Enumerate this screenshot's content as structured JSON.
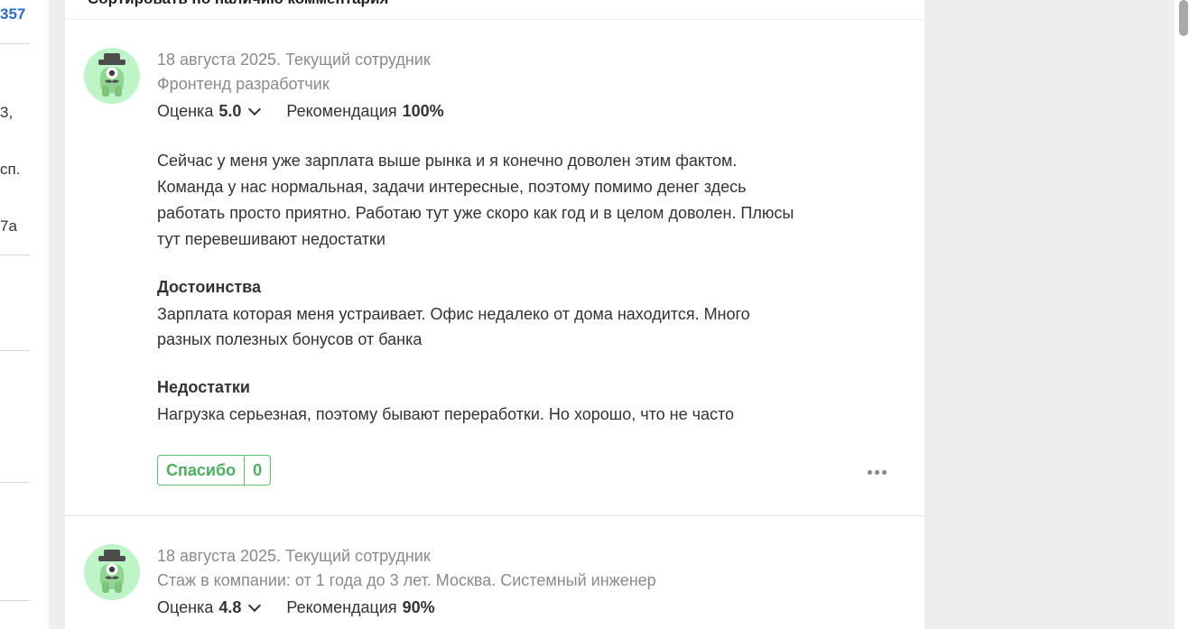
{
  "sidebar_fragments": {
    "f1": "357",
    "f2": "3,",
    "f3": "сп.",
    "f4": "7а"
  },
  "sort_bar": {
    "label": "Сортировать по наличию комментария"
  },
  "reviews": [
    {
      "date_status": "18 августа 2025. Текущий сотрудник",
      "position": "Фронтенд разработчик",
      "rating_label": "Оценка",
      "rating_value": "5.0",
      "recommend_label": "Рекомендация",
      "recommend_value": "100%",
      "body": "Сейчас у меня уже зарплата выше рынка и я конечно доволен этим фактом. Команда у нас нормальная, задачи интересные, поэтому помимо денег здесь работать просто приятно. Работаю тут уже скоро как год и в целом доволен. Плюсы тут перевешивают недостатки",
      "pros_title": "Достоинства",
      "pros_text": "Зарплата которая меня устраивает. Офис недалеко от дома находится. Много разных полезных бонусов от банка",
      "cons_title": "Недостатки",
      "cons_text": "Нагрузка серьезная, поэтому бывают переработки. Но хорошо, что не часто",
      "thanks_label": "Спасибо",
      "thanks_count": "0"
    },
    {
      "date_status": "18 августа 2025. Текущий сотрудник",
      "position": "Стаж в компании: от 1 года до 3 лет. Москва. Системный инженер",
      "rating_label": "Оценка",
      "rating_value": "4.8",
      "recommend_label": "Рекомендация",
      "recommend_value": "90%"
    }
  ],
  "icons": {
    "avatar": "anonymous-mascot-icon",
    "more": "more-dots-icon",
    "chevron": "chevron-down-icon"
  },
  "colors": {
    "avatar_bg": "#bdf5c6",
    "thanks_green": "#4cb060",
    "link_blue": "#2a6ac8"
  }
}
